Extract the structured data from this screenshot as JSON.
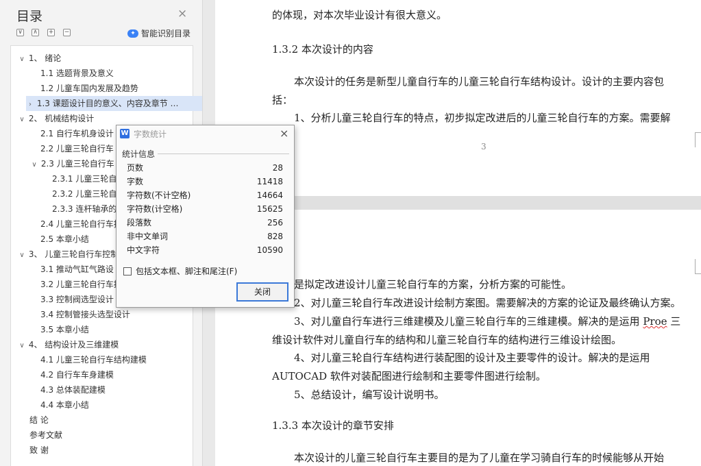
{
  "toc": {
    "title": "目录",
    "close_glyph": "×",
    "toolbar_glyphs": [
      "∨",
      "∧",
      "+",
      "−"
    ],
    "smart_label": "智能识别目录",
    "items": [
      {
        "arrow": "∨",
        "text": "1、 绪论"
      },
      {
        "arrow": "",
        "text": "1.1 选题背景及意义"
      },
      {
        "arrow": "",
        "text": "1.2 儿童车国内发展及趋势"
      },
      {
        "arrow": "›",
        "text": "1.3 课题设计目的意义、内容及章节 …"
      },
      {
        "arrow": "∨",
        "text": "2、 机械结构设计"
      },
      {
        "arrow": "",
        "text": "2.1 自行车机身设计"
      },
      {
        "arrow": "",
        "text": "2.2 儿童三轮自行车"
      },
      {
        "arrow": "∨",
        "text": "2.3 儿童三轮自行车"
      },
      {
        "arrow": "",
        "text": "2.3.1 儿童三轮自"
      },
      {
        "arrow": "",
        "text": "2.3.2 儿童三轮自"
      },
      {
        "arrow": "",
        "text": "2.3.3 连杆轴承的选"
      },
      {
        "arrow": "",
        "text": "2.4 儿童三轮自行车推"
      },
      {
        "arrow": "",
        "text": "2.5 本章小结"
      },
      {
        "arrow": "∨",
        "text": "3、 儿童三轮自行车控制"
      },
      {
        "arrow": "",
        "text": "3.1 推动气缸气路设"
      },
      {
        "arrow": "",
        "text": "3.2 儿童三轮自行车控"
      },
      {
        "arrow": "",
        "text": "3.3 控制阀选型设计"
      },
      {
        "arrow": "",
        "text": "3.4 控制管接头选型设计"
      },
      {
        "arrow": "",
        "text": "3.5 本章小结"
      },
      {
        "arrow": "∨",
        "text": "4、 结构设计及三维建模"
      },
      {
        "arrow": "",
        "text": "4.1 儿童三轮自行车结构建模"
      },
      {
        "arrow": "",
        "text": "4.2 自行车车身建模"
      },
      {
        "arrow": "",
        "text": "4.3 总体装配建模"
      },
      {
        "arrow": "",
        "text": "4.4 本章小结"
      },
      {
        "arrow": "",
        "text": "结 论"
      },
      {
        "arrow": "",
        "text": "参考文献"
      },
      {
        "arrow": "",
        "text": "致 谢"
      }
    ]
  },
  "document": {
    "page1_lines": [
      "的体现，对本次毕业设计有很大意义。",
      "1.3.2  本次设计的内容",
      "本次设计的任务是新型儿童自行车的儿童三轮自行车结构设计。设计的主要内容包",
      "括：",
      "1、分析儿童三轮自行车的特点，初步拟定改进后的儿童三轮自行车的方案。需要解"
    ],
    "page_number": "3",
    "page2_lines": [
      "是拟定改进设计儿童三轮自行车的方案，分析方案的可能性。",
      "2、对儿童三轮自行车改进设计绘制方案图。需要解决的方案的论证及最终确认方案。",
      "3、对儿童自行车进行三维建模及儿童三轮自行车的三维建模。解决的是运用",
      "Proe",
      "三",
      "维设计软件对儿童自行车的结构和儿童三轮自行车的结构进行三维设计绘图。",
      "4、对儿童三轮自行车结构进行装配图的设计及主要零件的设计。解决的是运用",
      "AUTOCAD 软件对装配图进行绘制和主要零件图进行绘制。",
      "5、总结设计，编写设计说明书。",
      "1.3.3  本次设计的章节安排",
      "本次设计的儿童三轮自行车主要目的是为了儿童在学习骑自行车的时候能够从开始"
    ]
  },
  "dialog": {
    "title": "字数统计",
    "close_glyph": "×",
    "section": "统计信息",
    "stats": [
      {
        "label": "页数",
        "value": "28"
      },
      {
        "label": "字数",
        "value": "11418"
      },
      {
        "label": "字符数(不计空格)",
        "value": "14664"
      },
      {
        "label": "字符数(计空格)",
        "value": "15625"
      },
      {
        "label": "段落数",
        "value": "256"
      },
      {
        "label": "非中文单词",
        "value": "828"
      },
      {
        "label": "中文字符",
        "value": "10590"
      }
    ],
    "checkbox_label": "包括文本框、脚注和尾注(F)",
    "checkbox_checked": false,
    "button_label": "关闭",
    "accent_color": "#3a78d8"
  }
}
